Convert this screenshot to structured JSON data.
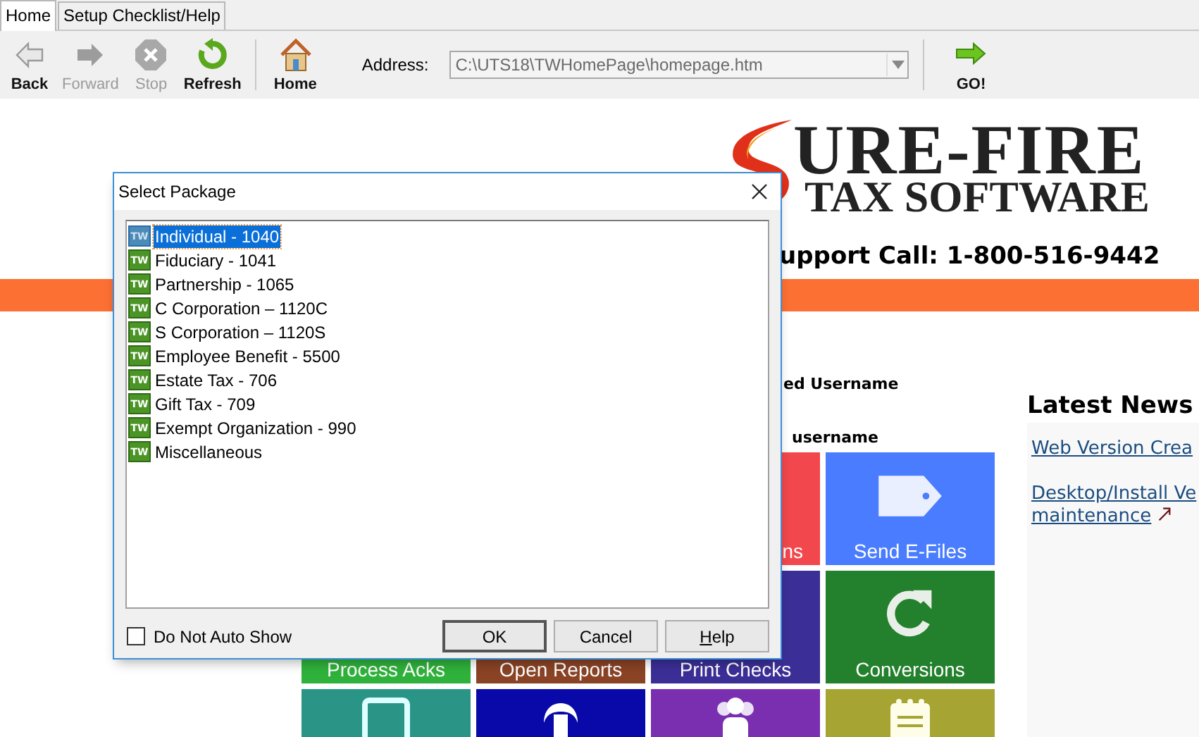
{
  "tabs": [
    {
      "label": "Home",
      "selected": true
    },
    {
      "label": "Setup Checklist/Help",
      "selected": false
    }
  ],
  "toolbar": {
    "buttons": [
      {
        "label": "Back",
        "kind": "back",
        "disabled": false
      },
      {
        "label": "Forward",
        "kind": "forward",
        "disabled": true
      },
      {
        "label": "Stop",
        "kind": "stop",
        "disabled": true
      },
      {
        "label": "Refresh",
        "kind": "refresh",
        "disabled": false
      },
      {
        "label": "Home",
        "kind": "home",
        "disabled": false
      }
    ],
    "address_label": "Address:",
    "address_value": "C:\\UTS18\\TWHomePage\\homepage.htm",
    "go_label": "GO!"
  },
  "page": {
    "logo": {
      "line1": "URE-FIRE",
      "line2": "TAX SOFTWARE"
    },
    "support": "upport Call: 1-800-516-9442",
    "login_texts": [
      "ed Username",
      "username"
    ],
    "tile_rows": [
      [
        {
          "label": "ns",
          "color": "#f2474c",
          "kind": "partial"
        },
        {
          "label": "Send E-Files",
          "color": "#4a7cff",
          "kind": "tag"
        }
      ],
      [
        {
          "label": "Process Acks",
          "color": "#2fb23b",
          "kind": "plain"
        },
        {
          "label": "Open Reports",
          "color": "#8a4325",
          "kind": "plain"
        },
        {
          "label": "Print Checks",
          "color": "#3b2f97",
          "kind": "plain"
        },
        {
          "label": "Conversions",
          "color": "#23802c",
          "kind": "refresh"
        }
      ],
      [
        {
          "color": "#2a9586",
          "kind": "frame"
        },
        {
          "color": "#0909a9",
          "kind": "emblem"
        },
        {
          "color": "#7a2eb0",
          "kind": "people"
        },
        {
          "color": "#a6a534",
          "kind": "notepad"
        }
      ]
    ],
    "news": {
      "title": "Latest News",
      "links": [
        {
          "lines": [
            "Web Version Crea"
          ]
        },
        {
          "lines": [
            "Desktop/Install Ve",
            "maintenance"
          ],
          "external": true
        }
      ]
    }
  },
  "dialog": {
    "title": "Select Package",
    "items": [
      {
        "label": "Individual - 1040",
        "badge": "TW",
        "selected": true
      },
      {
        "label": "Fiduciary - 1041",
        "badge": "TW",
        "selected": false
      },
      {
        "label": "Partnership - 1065",
        "badge": "TW",
        "selected": false
      },
      {
        "label": "C Corporation – 1120C",
        "badge": "TW",
        "selected": false
      },
      {
        "label": "S Corporation – 1120S",
        "badge": "TW",
        "selected": false
      },
      {
        "label": "Employee Benefit - 5500",
        "badge": "TW",
        "selected": false
      },
      {
        "label": "Estate Tax - 706",
        "badge": "TW",
        "selected": false
      },
      {
        "label": "Gift Tax - 709",
        "badge": "TW",
        "selected": false
      },
      {
        "label": "Exempt Organization - 990",
        "badge": "TW",
        "selected": false
      },
      {
        "label": "Miscellaneous",
        "badge": "TW",
        "selected": false
      }
    ],
    "checkbox": {
      "label": "Do Not Auto Show",
      "checked": false
    },
    "buttons": [
      {
        "label": "OK",
        "default": true
      },
      {
        "label": "Cancel",
        "default": false
      },
      {
        "label": "Help",
        "default": false
      }
    ]
  }
}
